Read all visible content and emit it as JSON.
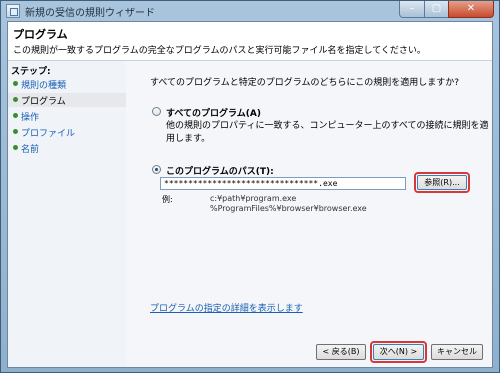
{
  "window": {
    "title": "新規の受信の規則ウィザード"
  },
  "titlebar": {
    "min": "–",
    "max": "▢",
    "close": "✕"
  },
  "header": {
    "title": "プログラム",
    "description": "この規則が一致するプログラムの完全なプログラムのパスと実行可能ファイル名を指定してください。"
  },
  "steps": {
    "title": "ステップ:",
    "items": [
      {
        "label": "規則の種類"
      },
      {
        "label": "プログラム"
      },
      {
        "label": "操作"
      },
      {
        "label": "プロファイル"
      },
      {
        "label": "名前"
      }
    ]
  },
  "main": {
    "question": "すべてのプログラムと特定のプログラムのどちらにこの規則を適用しますか?",
    "option_all": {
      "label": "すべてのプログラム(A)",
      "description": "他の規則のプロパティに一致する、コンピューター上のすべての接続に規則を適用します。"
    },
    "option_path": {
      "label": "このプログラムのパス(T):",
      "value": "********************************.exe",
      "browse": "参照(R)..."
    },
    "example": {
      "label": "例:",
      "lines": [
        "c:¥path¥program.exe",
        "%ProgramFiles%¥browser¥browser.exe"
      ]
    },
    "detail_link": "プログラムの指定の詳細を表示します"
  },
  "footer": {
    "back": "< 戻る(B)",
    "next": "次へ(N) >",
    "cancel": "キャンセル"
  }
}
